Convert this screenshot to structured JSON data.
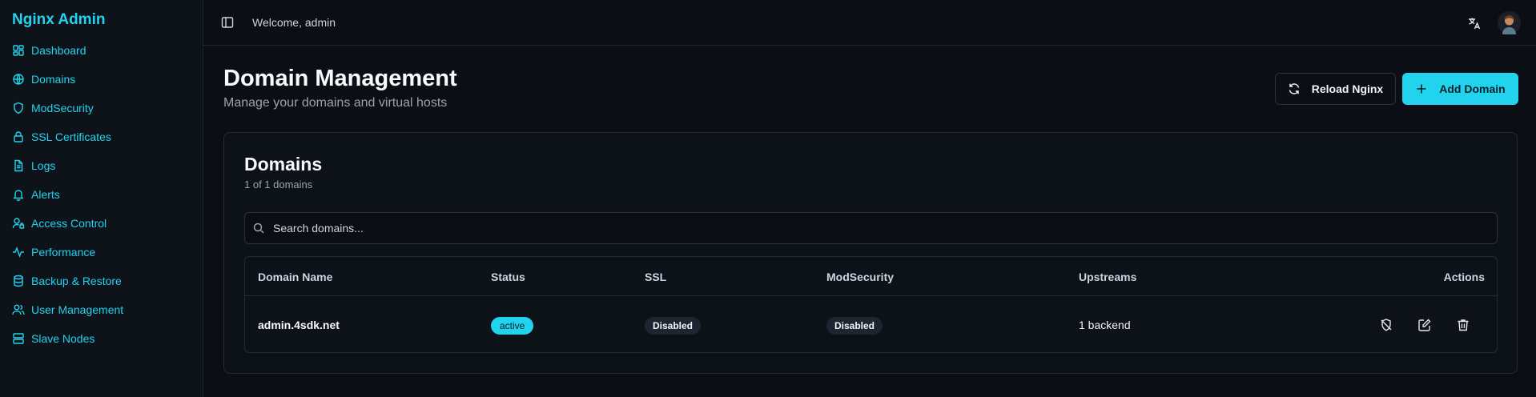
{
  "app": {
    "brand": "Nginx Admin"
  },
  "sidebar": {
    "items": [
      {
        "label": "Dashboard",
        "icon": "dashboard-icon"
      },
      {
        "label": "Domains",
        "icon": "globe-icon"
      },
      {
        "label": "ModSecurity",
        "icon": "shield-icon"
      },
      {
        "label": "SSL Certificates",
        "icon": "lock-icon"
      },
      {
        "label": "Logs",
        "icon": "file-text-icon"
      },
      {
        "label": "Alerts",
        "icon": "bell-icon"
      },
      {
        "label": "Access Control",
        "icon": "user-lock-icon"
      },
      {
        "label": "Performance",
        "icon": "activity-icon"
      },
      {
        "label": "Backup & Restore",
        "icon": "database-icon"
      },
      {
        "label": "User Management",
        "icon": "users-icon"
      },
      {
        "label": "Slave Nodes",
        "icon": "server-icon"
      }
    ]
  },
  "header": {
    "welcome": "Welcome, admin"
  },
  "page": {
    "title": "Domain Management",
    "subtitle": "Manage your domains and virtual hosts",
    "reload_label": "Reload Nginx",
    "add_label": "Add Domain"
  },
  "card": {
    "title": "Domains",
    "count": "1 of 1 domains",
    "search_placeholder": "Search domains..."
  },
  "table": {
    "columns": [
      "Domain Name",
      "Status",
      "SSL",
      "ModSecurity",
      "Upstreams",
      "Actions"
    ],
    "rows": [
      {
        "domain": "admin.4sdk.net",
        "status": "active",
        "ssl": "Disabled",
        "modsecurity": "Disabled",
        "upstreams": "1 backend"
      }
    ]
  },
  "colors": {
    "accent": "#22d3ee",
    "background": "#0b0f15",
    "sidebar": "#0e131a"
  }
}
